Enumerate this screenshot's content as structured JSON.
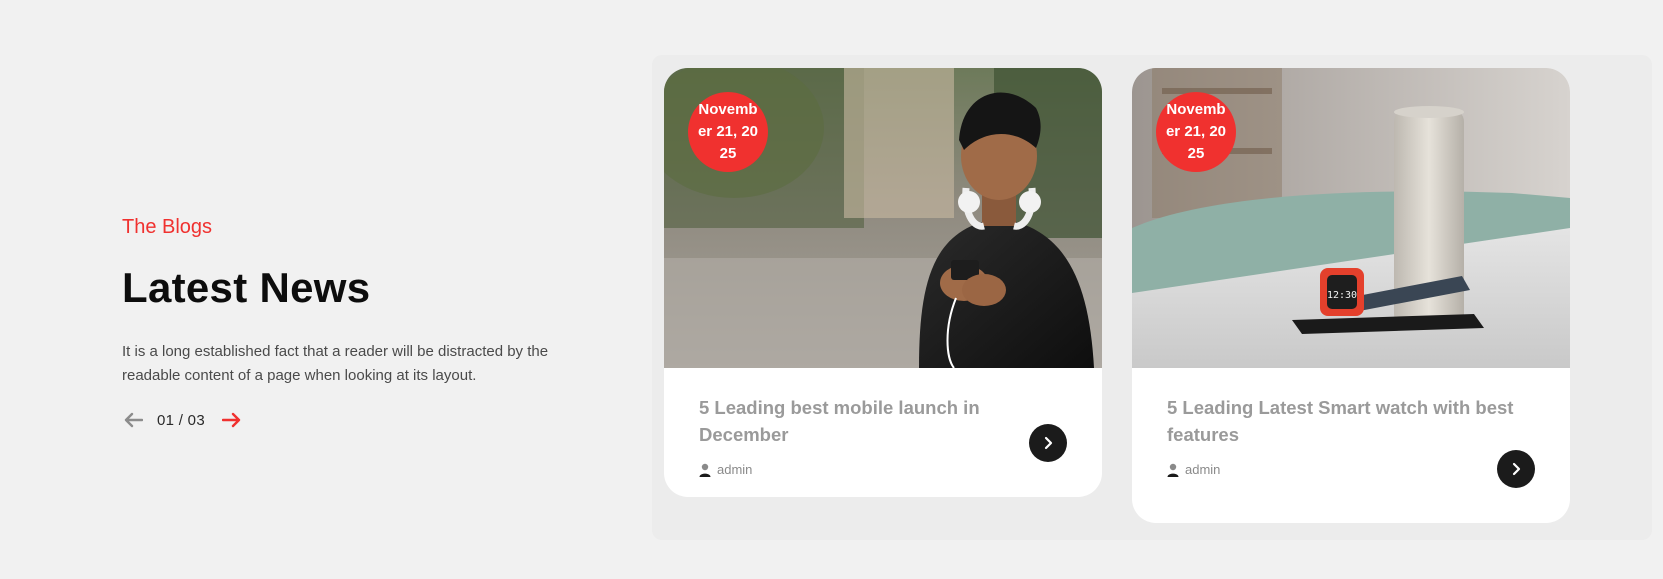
{
  "intro": {
    "eyebrow": "The Blogs",
    "heading": "Latest News",
    "description": "It is a long established fact that a reader will be distracted by the readable content of a page when looking at its layout.",
    "pager": {
      "current": "01",
      "separator": "/",
      "total": "03",
      "display": "01 / 03"
    }
  },
  "posts": [
    {
      "date": "November 21, 2025",
      "title": "5 Leading best mobile launch in December",
      "author": "admin",
      "image": "young-man-with-smartphone-and-headphones"
    },
    {
      "date": "November 21, 2025",
      "title": "5 Leading Latest Smart watch with best features",
      "author": "admin",
      "image": "smartwatch-and-speaker-on-table"
    }
  ],
  "icons": {
    "prev": "arrow-left-icon",
    "next": "arrow-right-icon",
    "author": "user-icon",
    "go": "chevron-right-icon"
  },
  "colors": {
    "accent": "#f0312f",
    "background": "#f1f1f1",
    "card": "#ffffff",
    "button": "#1b1b1b",
    "arrow_inactive": "#8c8c8c"
  }
}
